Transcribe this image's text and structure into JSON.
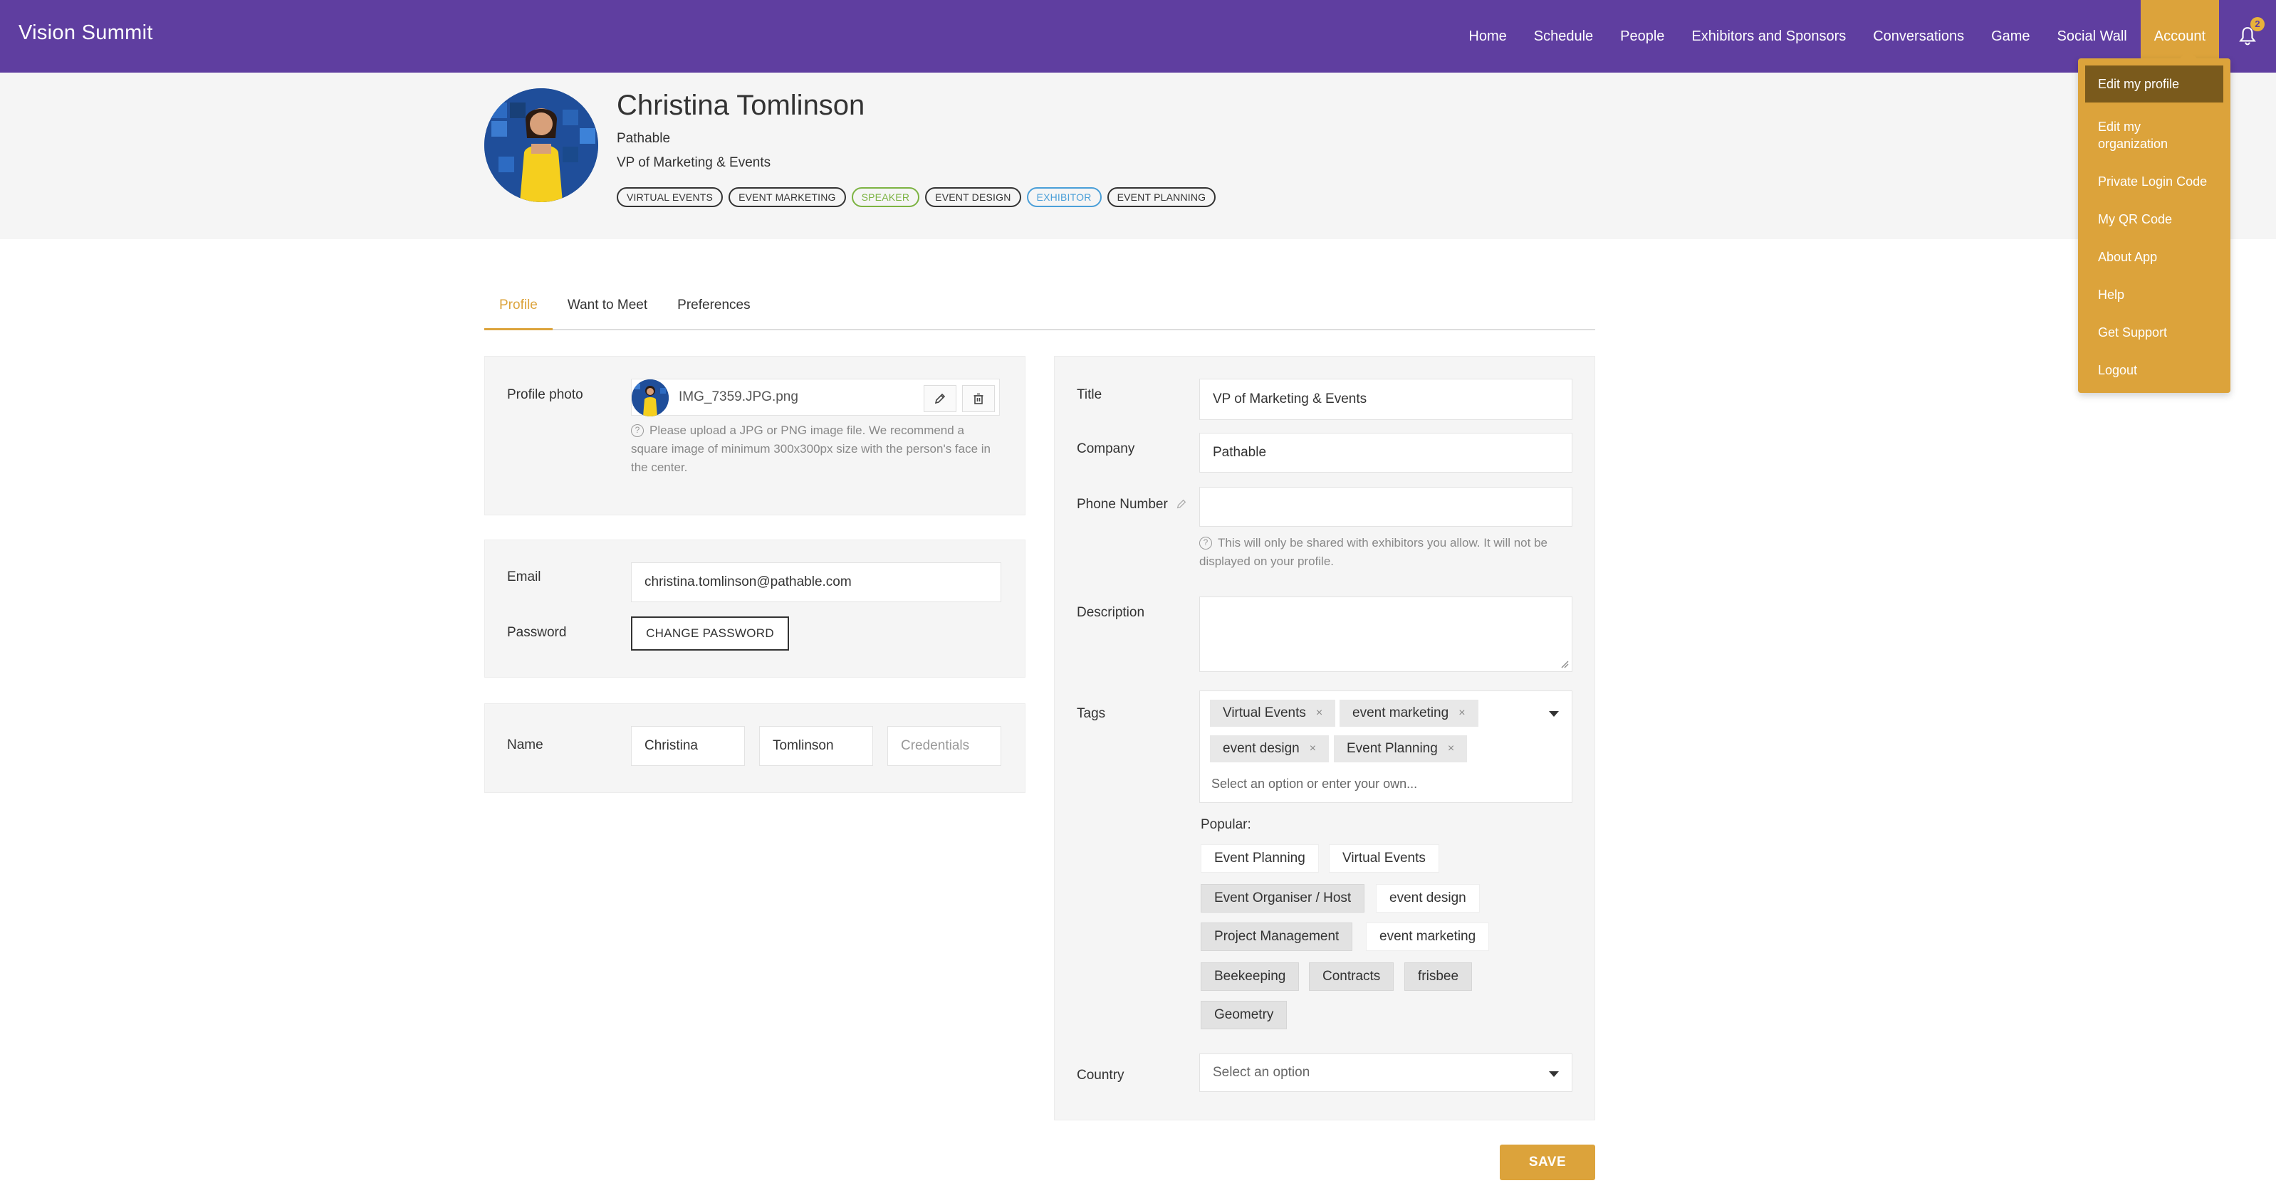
{
  "app": {
    "brand": "Vision Summit"
  },
  "nav": {
    "items": [
      "Home",
      "Schedule",
      "People",
      "Exhibitors and Sponsors",
      "Conversations",
      "Game",
      "Social Wall"
    ],
    "account": "Account",
    "notification_count": "2"
  },
  "dropdown": {
    "items": [
      "Edit my profile",
      "Edit my organization",
      "Private Login Code",
      "My QR Code",
      "About App",
      "Help",
      "Get Support",
      "Logout"
    ]
  },
  "profile": {
    "name": "Christina Tomlinson",
    "company": "Pathable",
    "title": "VP of Marketing & Events",
    "badges": [
      "VIRTUAL EVENTS",
      "EVENT MARKETING",
      "SPEAKER",
      "EVENT DESIGN",
      "EXHIBITOR",
      "EVENT PLANNING"
    ]
  },
  "tabs": [
    "Profile",
    "Want to Meet",
    "Preferences"
  ],
  "photo": {
    "label": "Profile photo",
    "filename": "IMG_7359.JPG.png",
    "help": "Please upload a JPG or PNG image file. We recommend a square image of minimum 300x300px size with the person's face in the center."
  },
  "account": {
    "email_label": "Email",
    "email": "christina.tomlinson@pathable.com",
    "password_label": "Password",
    "change_password": "CHANGE PASSWORD"
  },
  "name_card": {
    "label": "Name",
    "first": "Christina",
    "last": "Tomlinson",
    "credentials_placeholder": "Credentials"
  },
  "details": {
    "title_label": "Title",
    "title_value": "VP of Marketing & Events",
    "company_label": "Company",
    "company_value": "Pathable",
    "phone_label": "Phone Number",
    "phone_value": "",
    "phone_help": "This will only be shared with exhibitors you allow. It will not be displayed on your profile.",
    "description_label": "Description",
    "tags_label": "Tags",
    "tags_selected": [
      "Virtual Events",
      "event marketing",
      "event design",
      "Event Planning"
    ],
    "tags_placeholder": "Select an option or enter your own...",
    "popular_label": "Popular:",
    "popular": [
      "Event Planning",
      "Virtual Events",
      "Event Organiser / Host",
      "event design",
      "Project Management",
      "event marketing",
      "Beekeeping",
      "Contracts",
      "frisbee",
      "Geometry"
    ],
    "country_label": "Country",
    "country_placeholder": "Select an option"
  },
  "save": "SAVE",
  "colors": {
    "primary": "#5f3ea0",
    "accent": "#dca33b",
    "speaker": "#7cb342",
    "exhibitor": "#4a9fd8"
  }
}
